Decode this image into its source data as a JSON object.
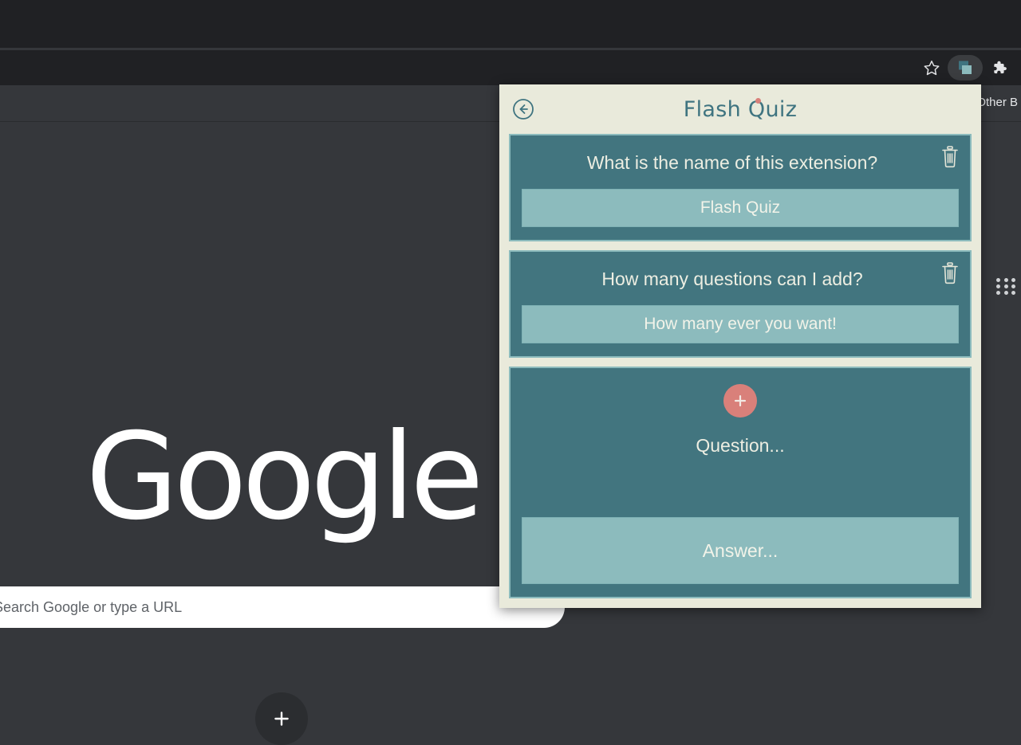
{
  "browser": {
    "toolbar": {
      "bookmark_icon": "star-icon",
      "extension_icon": "flash-quiz-extension-icon",
      "extensions_menu_icon": "puzzle-piece-icon"
    },
    "bookmarks_bar": {
      "other_bookmarks_label": "Other B"
    }
  },
  "newtab": {
    "logo_text": "Google",
    "apps_icon": "apps-grid-icon",
    "search": {
      "icon": "search-icon",
      "placeholder": "Search Google or type a URL",
      "value": ""
    },
    "add_shortcut": {
      "icon": "plus-icon",
      "label": ""
    }
  },
  "popup": {
    "back_icon": "back-arrow-circle-icon",
    "title": "Flash Quiz",
    "cards": [
      {
        "question": "What is the name of this extension?",
        "answer": "Flash Quiz",
        "delete_icon": "trash-icon"
      },
      {
        "question": "How many questions can I add?",
        "answer": "How many ever you want!",
        "delete_icon": "trash-icon"
      }
    ],
    "new_card": {
      "add_icon": "plus-icon",
      "question_placeholder": "Question...",
      "answer_placeholder": "Answer..."
    }
  },
  "colors": {
    "cream": "#e9eadb",
    "teal_dark": "#42757f",
    "teal_light": "#8cbbbd",
    "title_teal": "#3f7480",
    "accent_salmon": "#d9807a",
    "chrome_dark": "#202124",
    "chrome_mid": "#35373b"
  }
}
